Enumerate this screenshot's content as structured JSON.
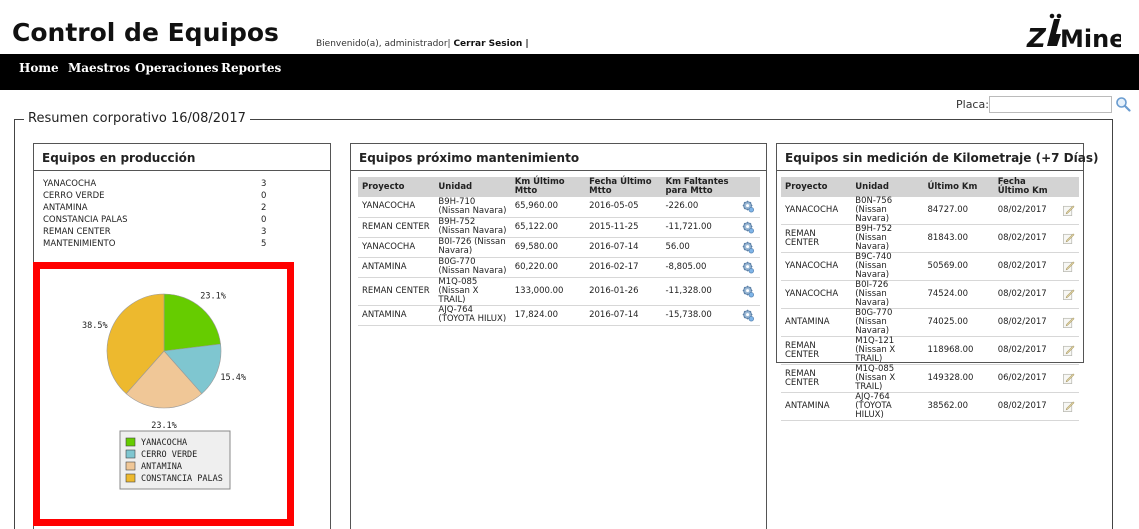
{
  "header": {
    "title": "Control de Equipos",
    "welcome": "Bienvenido(a), administrador|",
    "logout": "Cerrar Sesion |",
    "logo_text": "Z",
    "logo_suffix": "Mine"
  },
  "nav": {
    "items": [
      "Home",
      "Maestros",
      "Operaciones",
      "Reportes"
    ]
  },
  "search": {
    "label": "Placa:",
    "value": ""
  },
  "summary": {
    "legend": "Resumen corporativo 16/08/2017"
  },
  "produccion": {
    "title": "Equipos en producción",
    "rows": [
      {
        "name": "YANACOCHA",
        "value": "3"
      },
      {
        "name": "CERRO VERDE",
        "value": "0"
      },
      {
        "name": "ANTAMINA",
        "value": "2"
      },
      {
        "name": "CONSTANCIA PALAS",
        "value": "0"
      },
      {
        "name": "REMAN CENTER",
        "value": "3"
      },
      {
        "name": "MANTENIMIENTO",
        "value": "5"
      }
    ]
  },
  "chart_data": {
    "type": "pie",
    "slices": [
      {
        "label": "YANACOCHA",
        "value": 23.1,
        "color": "#66cc00",
        "text": "23.1%"
      },
      {
        "label": "CERRO VERDE",
        "value": 15.4,
        "color": "#7fc6d0",
        "text": "15.4%"
      },
      {
        "label": "ANTAMINA",
        "value": 23.1,
        "color": "#f0c797",
        "text": "23.1%"
      },
      {
        "label": "CONSTANCIA PALAS",
        "value": 38.5,
        "color": "#edb92e",
        "text": "38.5%"
      }
    ],
    "legend_position": "bottom"
  },
  "mantenimiento": {
    "title": "Equipos próximo mantenimiento",
    "headers": [
      "Proyecto",
      "Unidad",
      "Km Último Mtto",
      "Fecha Último Mtto",
      "Km Faltantes para Mtto"
    ],
    "rows": [
      [
        "YANACOCHA",
        "B9H-710 (Nissan Navara)",
        "65,960.00",
        "2016-05-05",
        "-226.00"
      ],
      [
        "REMAN CENTER",
        "B9H-752 (Nissan Navara)",
        "65,122.00",
        "2015-11-25",
        "-11,721.00"
      ],
      [
        "YANACOCHA",
        "B0I-726 (Nissan Navara)",
        "69,580.00",
        "2016-07-14",
        "56.00"
      ],
      [
        "ANTAMINA",
        "B0G-770 (Nissan Navara)",
        "60,220.00",
        "2016-02-17",
        "-8,805.00"
      ],
      [
        "REMAN CENTER",
        "M1Q-085 (Nissan X TRAIL)",
        "133,000.00",
        "2016-01-26",
        "-11,328.00"
      ],
      [
        "ANTAMINA",
        "AJQ-764 (TOYOTA HILUX)",
        "17,824.00",
        "2016-07-14",
        "-15,738.00"
      ]
    ]
  },
  "sin_medicion": {
    "title": "Equipos sin medición de Kilometraje (+7 Días)",
    "headers": [
      "Proyecto",
      "Unidad",
      "Último Km",
      "Fecha Último Km"
    ],
    "rows": [
      [
        "YANACOCHA",
        "B0N-756 (Nissan Navara)",
        "84727.00",
        "08/02/2017"
      ],
      [
        "REMAN CENTER",
        "B9H-752 (Nissan Navara)",
        "81843.00",
        "08/02/2017"
      ],
      [
        "YANACOCHA",
        "B9C-740 (Nissan Navara)",
        "50569.00",
        "08/02/2017"
      ],
      [
        "YANACOCHA",
        "B0I-726 (Nissan Navara)",
        "74524.00",
        "08/02/2017"
      ],
      [
        "ANTAMINA",
        "B0G-770 (Nissan Navara)",
        "74025.00",
        "08/02/2017"
      ],
      [
        "REMAN CENTER",
        "M1Q-121 (Nissan X TRAIL)",
        "118968.00",
        "08/02/2017"
      ],
      [
        "REMAN CENTER",
        "M1Q-085 (Nissan X TRAIL)",
        "149328.00",
        "06/02/2017"
      ],
      [
        "ANTAMINA",
        "AJQ-764 (TOYOTA HILUX)",
        "38562.00",
        "08/02/2017"
      ]
    ]
  },
  "icons": {
    "gear": "gear-icon",
    "edit": "edit-icon",
    "search": "search-icon"
  }
}
